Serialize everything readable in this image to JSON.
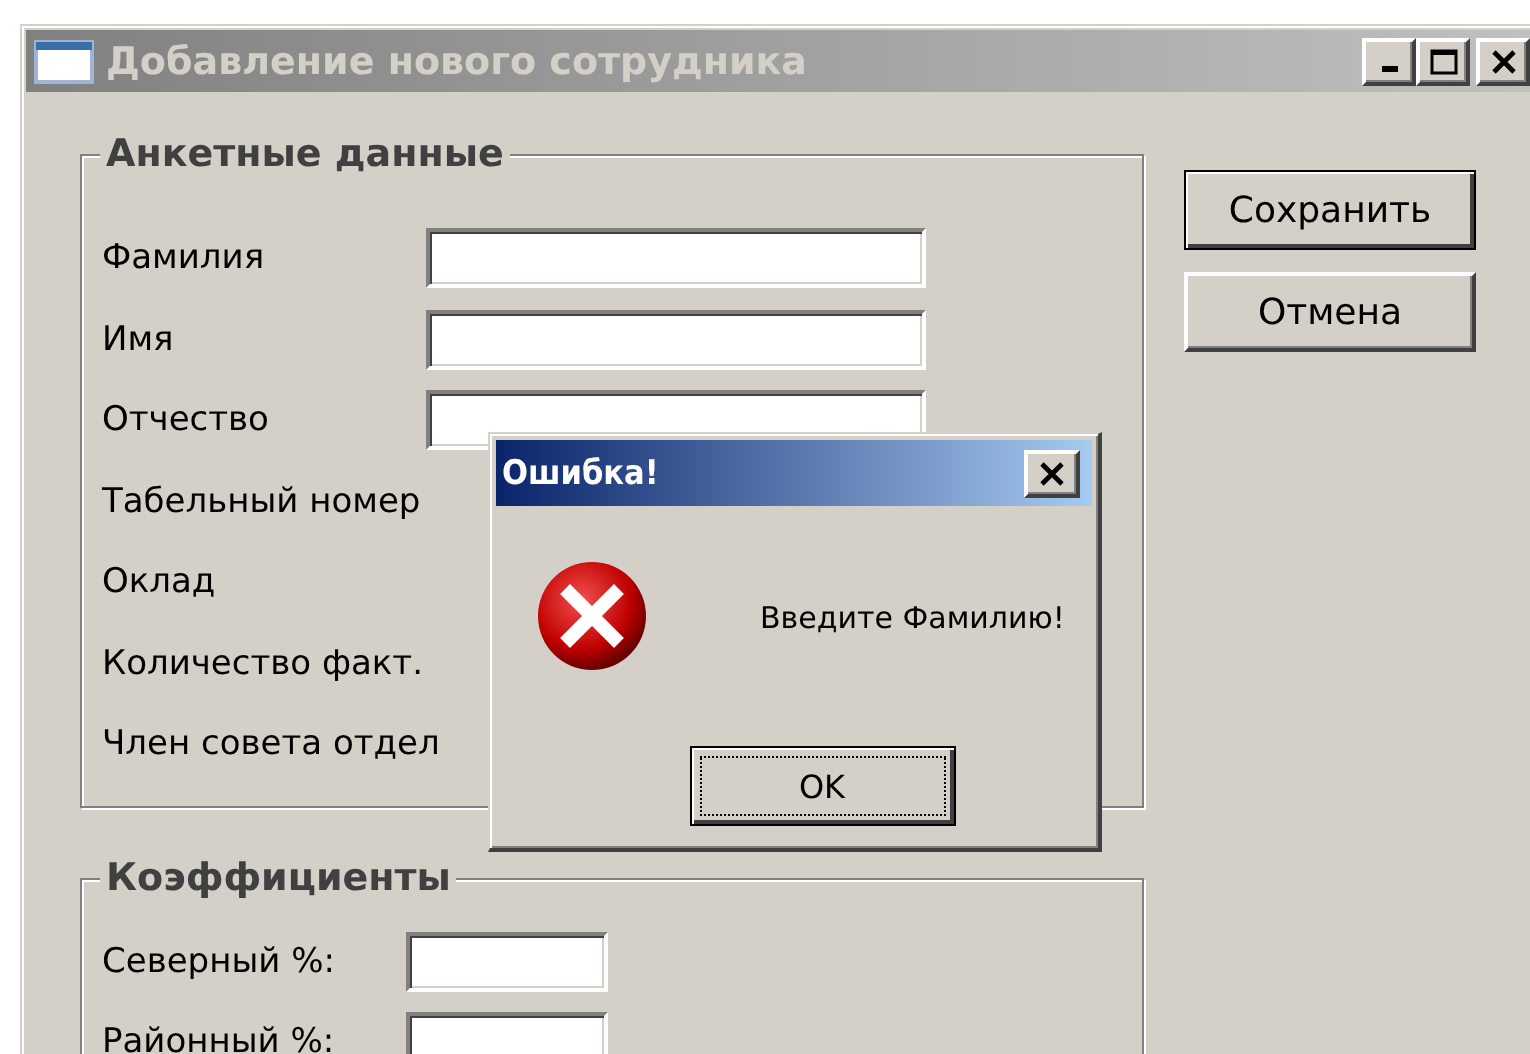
{
  "window": {
    "title": "Добавление нового сотрудника"
  },
  "personal_group": {
    "title": "Анкетные данные",
    "fields": [
      {
        "label": "Фамилия",
        "kind": "input"
      },
      {
        "label": "Имя",
        "kind": "input"
      },
      {
        "label": "Отчество",
        "kind": "input"
      },
      {
        "label": "Табельный номер",
        "kind": "label"
      },
      {
        "label": "Оклад",
        "kind": "label"
      },
      {
        "label": "Количество факт.",
        "kind": "label"
      },
      {
        "label": "Член совета отдел",
        "kind": "label"
      }
    ]
  },
  "buttons": [
    "Сохранить",
    "Отмена"
  ],
  "coef_group": {
    "title": "Коэффициенты",
    "fields": [
      {
        "label": "Северный %:",
        "kind": "input"
      },
      {
        "label": "Районный %:",
        "kind": "input"
      }
    ]
  },
  "dialog": {
    "title": "Ошибка!",
    "message": "Введите Фамилию!",
    "button": "OK"
  }
}
